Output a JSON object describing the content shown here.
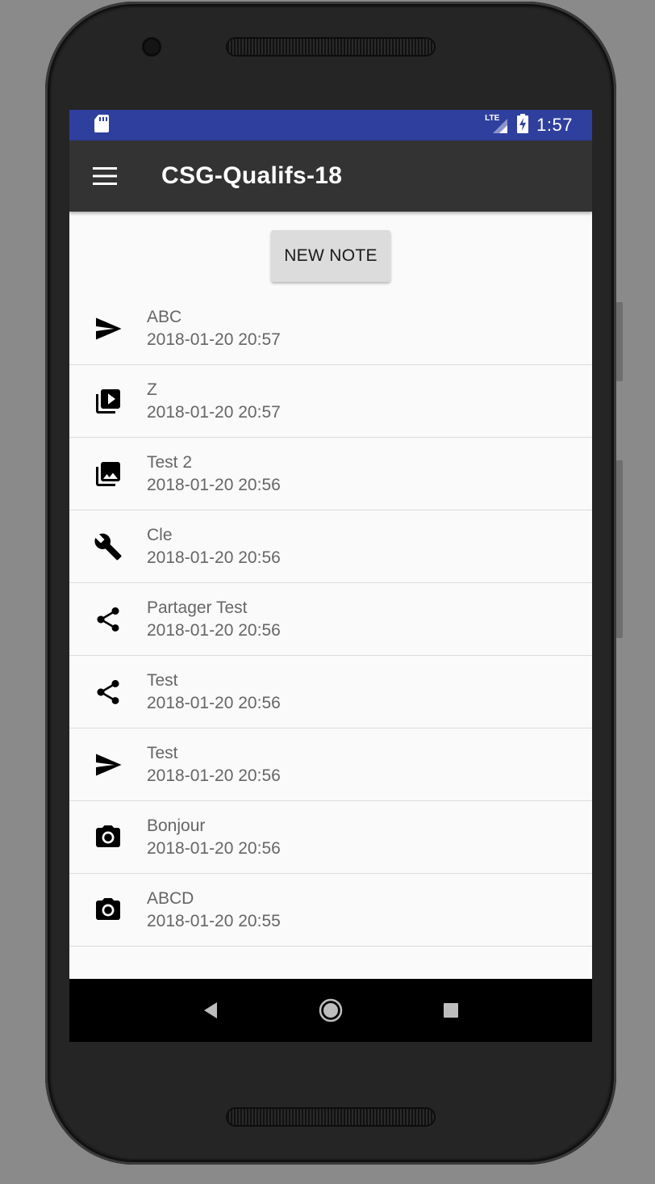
{
  "status_bar": {
    "time": "1:57",
    "network_label": "LTE",
    "icons": [
      "sd-card-icon",
      "lte-signal-icon",
      "battery-charging-icon"
    ]
  },
  "toolbar": {
    "title": "CSG-Qualifs-18",
    "menu_icon": "hamburger-menu-icon"
  },
  "main": {
    "new_note_label": "NEW NOTE",
    "notes": [
      {
        "icon": "send-icon",
        "title": "ABC",
        "date": "2018-01-20 20:57"
      },
      {
        "icon": "video-library-icon",
        "title": "Z",
        "date": "2018-01-20 20:57"
      },
      {
        "icon": "photo-library-icon",
        "title": "Test 2",
        "date": "2018-01-20 20:56"
      },
      {
        "icon": "wrench-icon",
        "title": "Cle",
        "date": "2018-01-20 20:56"
      },
      {
        "icon": "share-icon",
        "title": "Partager Test",
        "date": "2018-01-20 20:56"
      },
      {
        "icon": "share-icon",
        "title": "Test",
        "date": "2018-01-20 20:56"
      },
      {
        "icon": "send-icon",
        "title": "Test",
        "date": "2018-01-20 20:56"
      },
      {
        "icon": "camera-icon",
        "title": "Bonjour",
        "date": "2018-01-20 20:56"
      },
      {
        "icon": "camera-icon",
        "title": "ABCD",
        "date": "2018-01-20 20:55"
      }
    ]
  },
  "nav_bar": {
    "icons": [
      "back-icon",
      "home-icon",
      "recents-icon"
    ]
  },
  "colors": {
    "status_bar": "#2f3f9e",
    "toolbar": "#333333",
    "background": "#fafafa",
    "button": "#dcdcdc"
  }
}
